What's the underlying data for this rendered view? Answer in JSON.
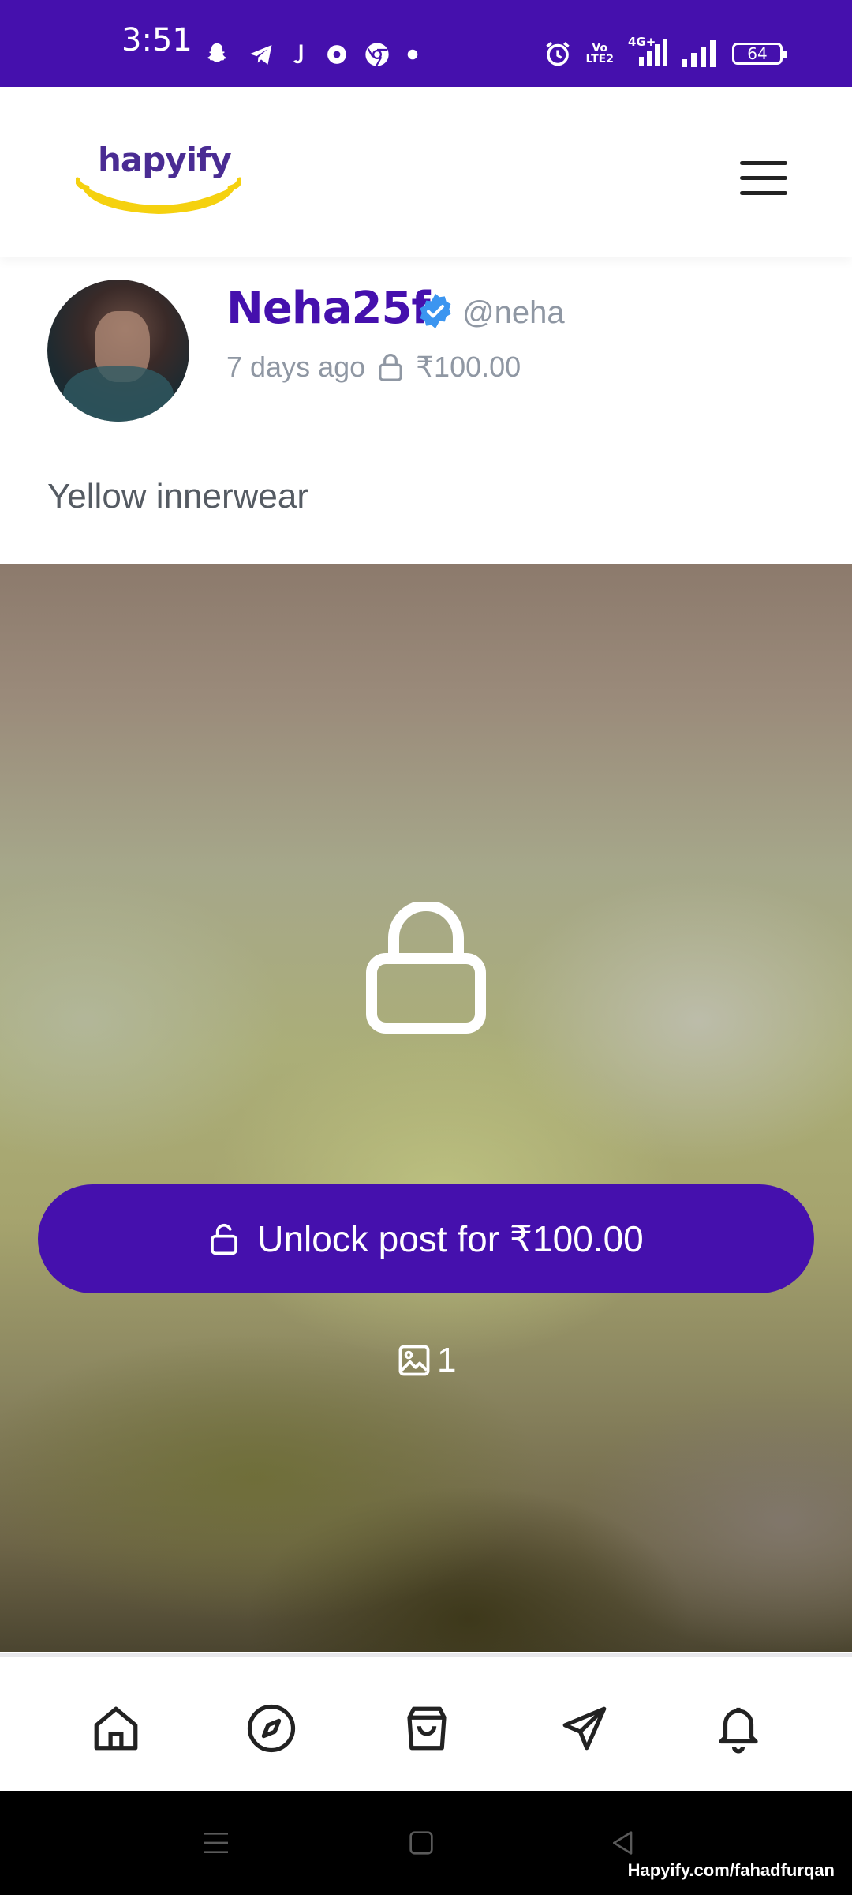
{
  "status_bar": {
    "time": "3:51",
    "lte_line1": "Vo",
    "lte_line2": "LTE2",
    "network": "4G+",
    "battery": "64",
    "notification_icons": [
      "snapchat-icon",
      "telegram-icon",
      "jiosaavn-icon",
      "app-icon",
      "chrome-icon",
      "more-dot-icon"
    ]
  },
  "header": {
    "logo_text": "hapyify",
    "menu_icon": "hamburger-menu-icon"
  },
  "post": {
    "display_name": "Neha25f",
    "username": "@neha",
    "time_ago": "7 days ago",
    "price": "₹100.00",
    "caption": "Yellow innerwear",
    "unlock_label": "Unlock post for ₹100.00",
    "media_count": "1"
  },
  "bottom_nav": {
    "items": [
      "home-icon",
      "explore-compass-icon",
      "shop-bag-icon",
      "messages-send-icon",
      "notifications-bell-icon"
    ]
  },
  "system_nav": {
    "watermark": "Hapyify.com/fahadfurqan"
  },
  "colors": {
    "brand": "#4510ad",
    "muted": "#8f97a3",
    "verified": "#3b95f0",
    "logo_smile": "#f5d10f"
  }
}
